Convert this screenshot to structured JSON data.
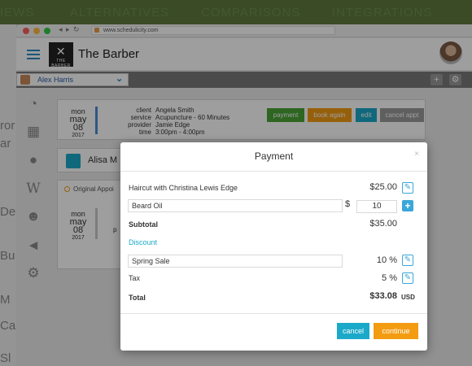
{
  "site": {
    "nav": [
      "IEWS",
      "ALTERNATIVES",
      "COMPARISONS",
      "INTEGRATIONS"
    ],
    "left_fragments": [
      "ror",
      "ar",
      "De",
      "Bu",
      "M",
      "Ca",
      "Sl"
    ]
  },
  "browser": {
    "nav_glyphs": "◂ ▸ ↻",
    "url": "www.schedulicity.com"
  },
  "app": {
    "title": "The Barber",
    "logo_text": "THE BARBER",
    "staff": {
      "name": "Alex Harris",
      "chevron": "⌄"
    },
    "tools": {
      "add": "+",
      "settings": "⚙"
    }
  },
  "appointment": {
    "date": {
      "dow": "mon",
      "month": "may",
      "day": "08",
      "year": "2017"
    },
    "labels": {
      "client": "client",
      "service": "service",
      "provider": "provider",
      "time": "time"
    },
    "values": {
      "client": "Angela Smith",
      "service": "Acupuncture - 60 Minutes",
      "provider": "Jamie Edge",
      "time": "3:00pm - 4:00pm"
    },
    "buttons": {
      "payment": "payment",
      "book_again": "book again",
      "edit": "edit",
      "cancel": "cancel appt"
    }
  },
  "client_card": {
    "name": "Alisa M"
  },
  "original_card": {
    "heading": "Original Appoi",
    "date": {
      "dow": "mon",
      "month": "may",
      "day": "08",
      "year": "2017"
    },
    "fragment": "p"
  },
  "modal": {
    "title": "Payment",
    "close": "×",
    "service_line": {
      "label": "Haircut with Christina Lewis Edge",
      "amount": "$25.00"
    },
    "product_line": {
      "value": "Beard Oil",
      "currency": "$",
      "qty": "10"
    },
    "subtotal": {
      "label": "Subtotal",
      "amount": "$35.00"
    },
    "discount_link": "Discount",
    "discount_line": {
      "value": "Spring Sale",
      "amount": "10 %"
    },
    "tax": {
      "label": "Tax",
      "amount": "5 %"
    },
    "total": {
      "label": "Total",
      "amount": "$33.08",
      "currency": "USD"
    },
    "buttons": {
      "cancel": "cancel",
      "continue": "continue"
    }
  },
  "colors": {
    "accent_blue": "#3ba6d8",
    "green": "#4aa336",
    "orange": "#f39c12",
    "teal": "#1ba9c9",
    "grey": "#9a9a9a"
  }
}
